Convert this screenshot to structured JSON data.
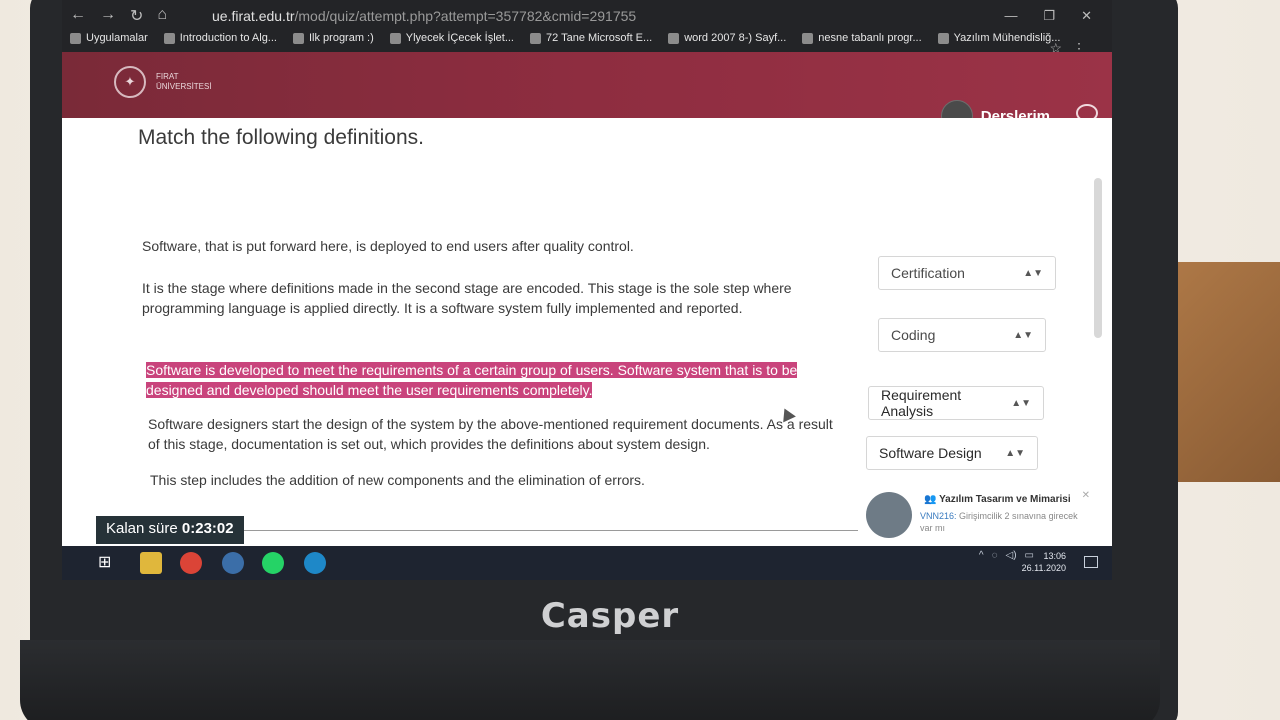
{
  "browser": {
    "url_host": "ue.firat.edu.tr",
    "url_path": "/mod/quiz/attempt.php?attempt=357782&cmid=291755",
    "bookmarks": [
      "Uygulamalar",
      "Introduction to Alg...",
      "Ilk program :)",
      "Ylyecek İÇecek İşlet...",
      "72 Tane Microsoft E...",
      "word 2007 8-) Sayf...",
      "nesne tabanlı progr...",
      "Yazılım Mühendisliğ..."
    ]
  },
  "header": {
    "logo_line1": "FIRAT",
    "logo_line2": "ÜNİVERSİTESİ",
    "nav_label": "Derslerim"
  },
  "question": {
    "title": "Match the following definitions.",
    "rows": [
      {
        "text": "Software, that is put forward here, is deployed to end users after quality control.",
        "answer": "Certification"
      },
      {
        "text": "It is the stage where definitions made in the second stage are encoded. This stage is the sole step where programming language is applied directly. It is a software system fully implemented and reported.",
        "answer": "Coding"
      },
      {
        "text": "Software is developed to meet the requirements of a certain group of users. Software system that is to be designed and developed should meet the user requirements completely.",
        "answer": "Requirement Analysis"
      },
      {
        "text": "Software designers start the design of the system by the above-mentioned requirement documents. As a result of this stage, documentation is set out, which provides the definitions about system design.",
        "answer": "Software Design"
      },
      {
        "text": "This step includes the addition of new components and the elimination of errors.",
        "answer": ""
      }
    ]
  },
  "timer": {
    "label": "Kalan süre",
    "value": "0:23:02"
  },
  "notification": {
    "title": "Yazılım Tasarım ve Mimarisi",
    "sender": "VNN216:",
    "message": "Girişimcilik 2 sınavına girecek var mı"
  },
  "taskbar": {
    "time": "13:06",
    "date": "26.11.2020"
  },
  "device": {
    "brand": "Casper"
  },
  "colors": {
    "header": "#8e2d40",
    "highlight": "#c9447c",
    "taskbar": "#1e2430",
    "timer_bg": "#263238"
  }
}
